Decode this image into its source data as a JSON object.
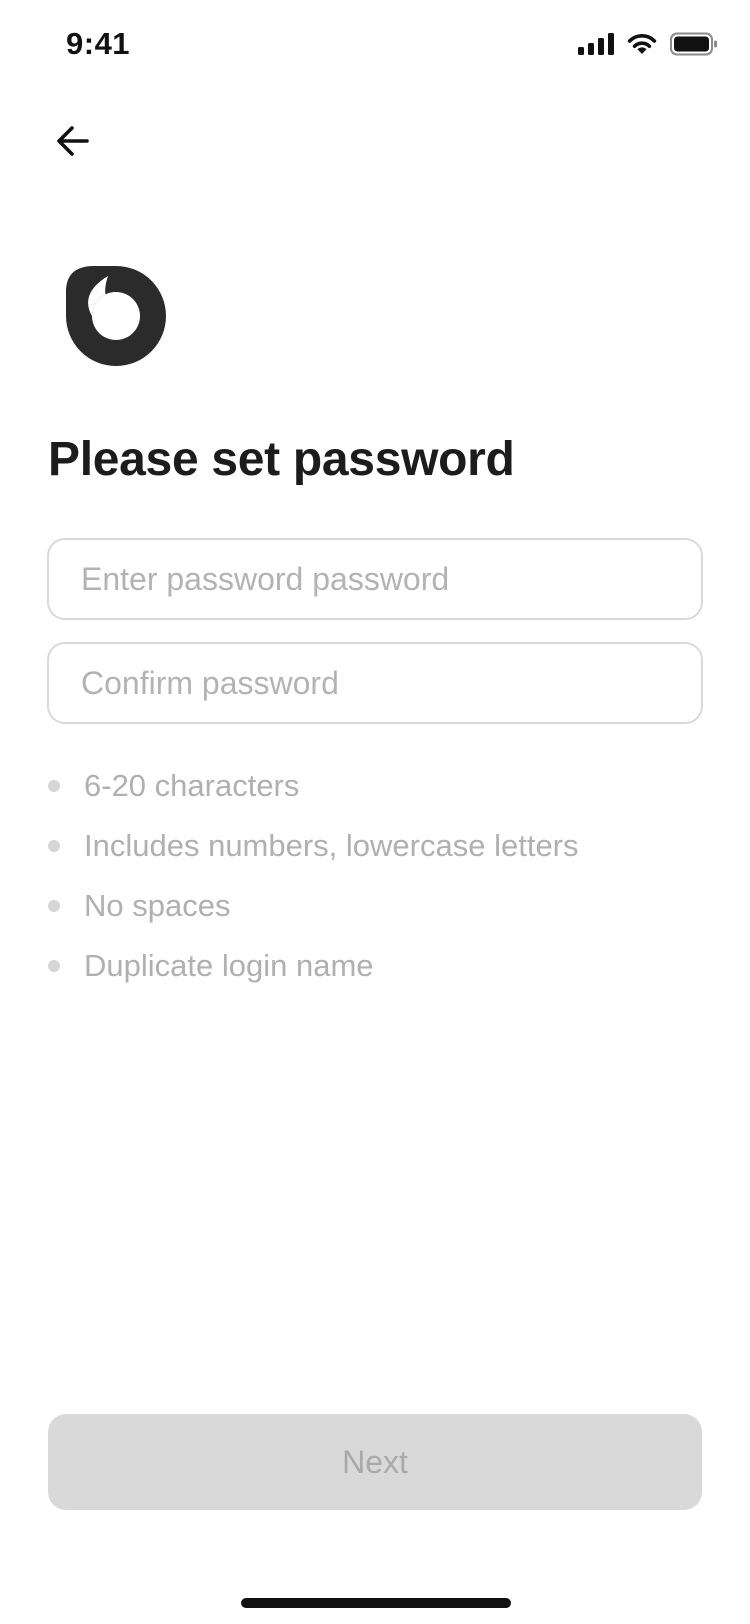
{
  "status_bar": {
    "time": "9:41",
    "icons": [
      "cellular-signal-icon",
      "wifi-icon",
      "battery-icon"
    ]
  },
  "nav": {
    "back_icon": "arrow-left-icon"
  },
  "logo": {
    "icon": "app-logo-icon",
    "color": "#2b2b2b"
  },
  "title": "Please set password",
  "form": {
    "password": {
      "value": "",
      "placeholder": "Enter password password"
    },
    "confirm": {
      "value": "",
      "placeholder": "Confirm password"
    }
  },
  "rules": [
    "6-20 characters",
    "Includes numbers, lowercase letters",
    "No spaces",
    "Duplicate login name"
  ],
  "next_button": {
    "label": "Next",
    "state": "disabled"
  },
  "colors": {
    "text_primary": "#1c1c1c",
    "placeholder": "#b3b3b3",
    "rule_text": "#b0b0b0",
    "button_disabled_bg": "#d9d9d9",
    "button_disabled_text": "#a9a9a9",
    "border": "#d9d9d9"
  }
}
